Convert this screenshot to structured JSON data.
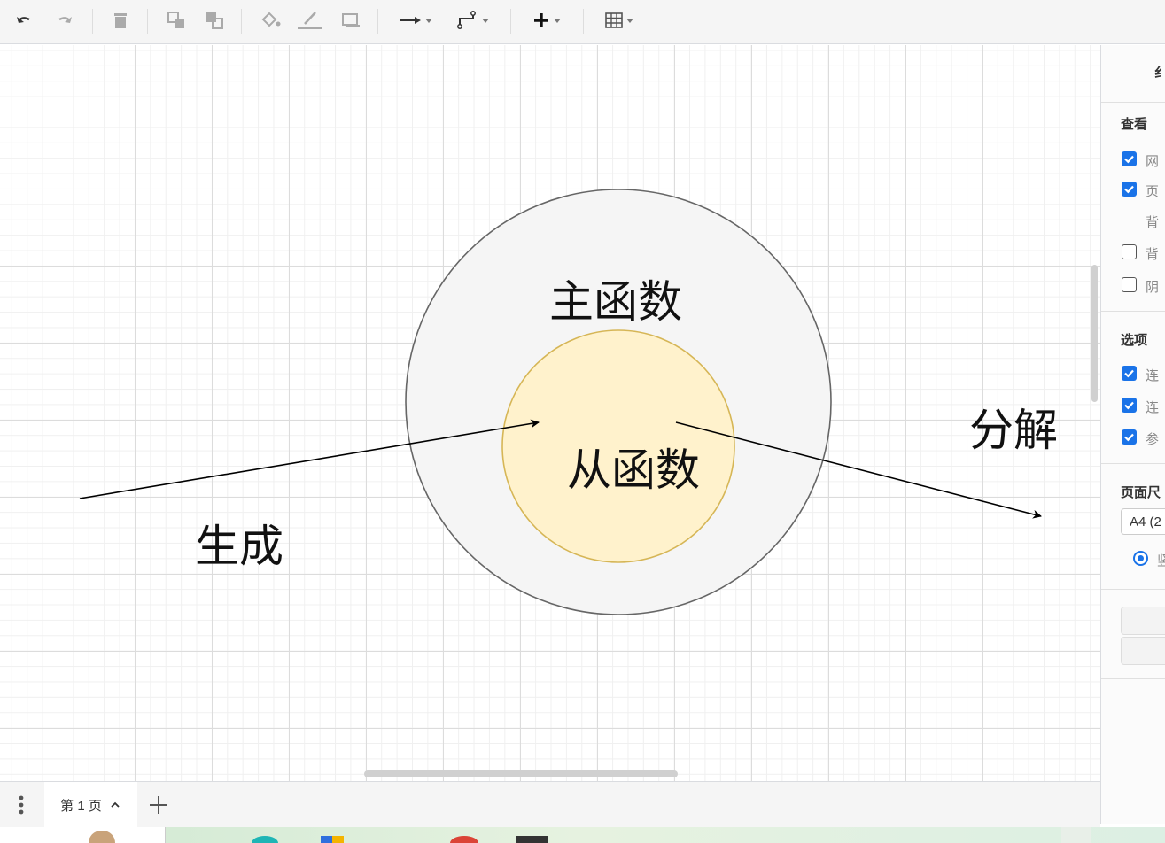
{
  "toolbar": {
    "icons": [
      "undo-icon",
      "redo-icon",
      "delete-icon",
      "to-front-icon",
      "to-back-icon",
      "fill-color-icon",
      "line-color-icon",
      "shadow-icon",
      "connection-icon",
      "waypoints-icon",
      "insert-icon",
      "table-icon"
    ]
  },
  "diagram": {
    "outer_circle_label": "主函数",
    "inner_circle_label": "从函数",
    "left_label": "生成",
    "right_label": "分解",
    "outer_fill": "#f5f5f5",
    "outer_stroke": "#666666",
    "inner_fill": "#fff2cc",
    "inner_stroke": "#d6b656"
  },
  "format_panel": {
    "title_partial": "纟",
    "view_section": "查看",
    "view_items": [
      {
        "label": "网",
        "checked": true
      },
      {
        "label": "页",
        "checked": true
      },
      {
        "label": "背",
        "checked": null
      },
      {
        "label": "背",
        "checked": false
      },
      {
        "label": "阴",
        "checked": false
      }
    ],
    "options_section": "选项",
    "options_items": [
      {
        "label": "连",
        "checked": true
      },
      {
        "label": "连",
        "checked": true
      },
      {
        "label": "参",
        "checked": true
      }
    ],
    "page_size_section": "页面尺",
    "page_size_value": "A4 (2",
    "orientation_label": "竖"
  },
  "pages": {
    "current_tab": "第 1 页"
  },
  "colors": {
    "accent": "#1a73e8"
  }
}
